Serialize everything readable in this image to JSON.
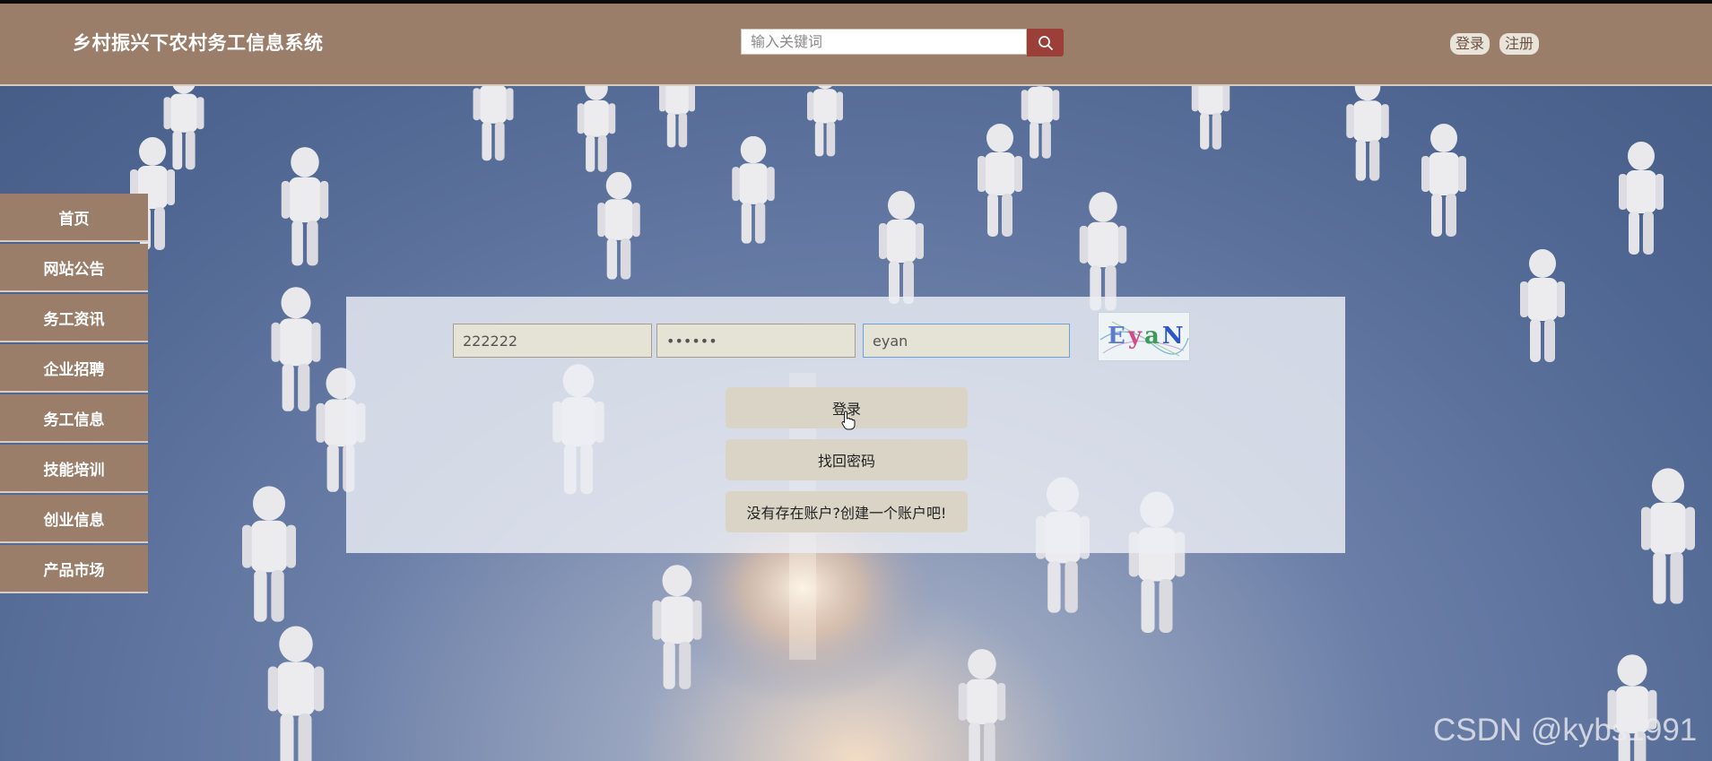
{
  "header": {
    "site_title": "乡村振兴下农村务工信息系统",
    "search_placeholder": "输入关键词",
    "login_label": "登录",
    "register_label": "注册"
  },
  "sidebar": {
    "items": [
      {
        "label": "首页"
      },
      {
        "label": "网站公告"
      },
      {
        "label": "务工资讯"
      },
      {
        "label": "企业招聘"
      },
      {
        "label": "务工信息"
      },
      {
        "label": "技能培训"
      },
      {
        "label": "创业信息"
      },
      {
        "label": "产品市场"
      }
    ]
  },
  "login_form": {
    "username_value": "222222",
    "password_value": "••••••",
    "captcha_value": "eyan",
    "captcha_image_text": "EyaN",
    "login_button": "登录",
    "recover_button": "找回密码",
    "register_link": "没有存在账户?创建一个账户吧!"
  },
  "watermark": "CSDN @kybs1991",
  "colors": {
    "header_bg": "#9b7e6a",
    "search_button": "#9b3f38",
    "sidebar_bg": "#9b7e6a",
    "panel_button": "#d9d4c6"
  }
}
